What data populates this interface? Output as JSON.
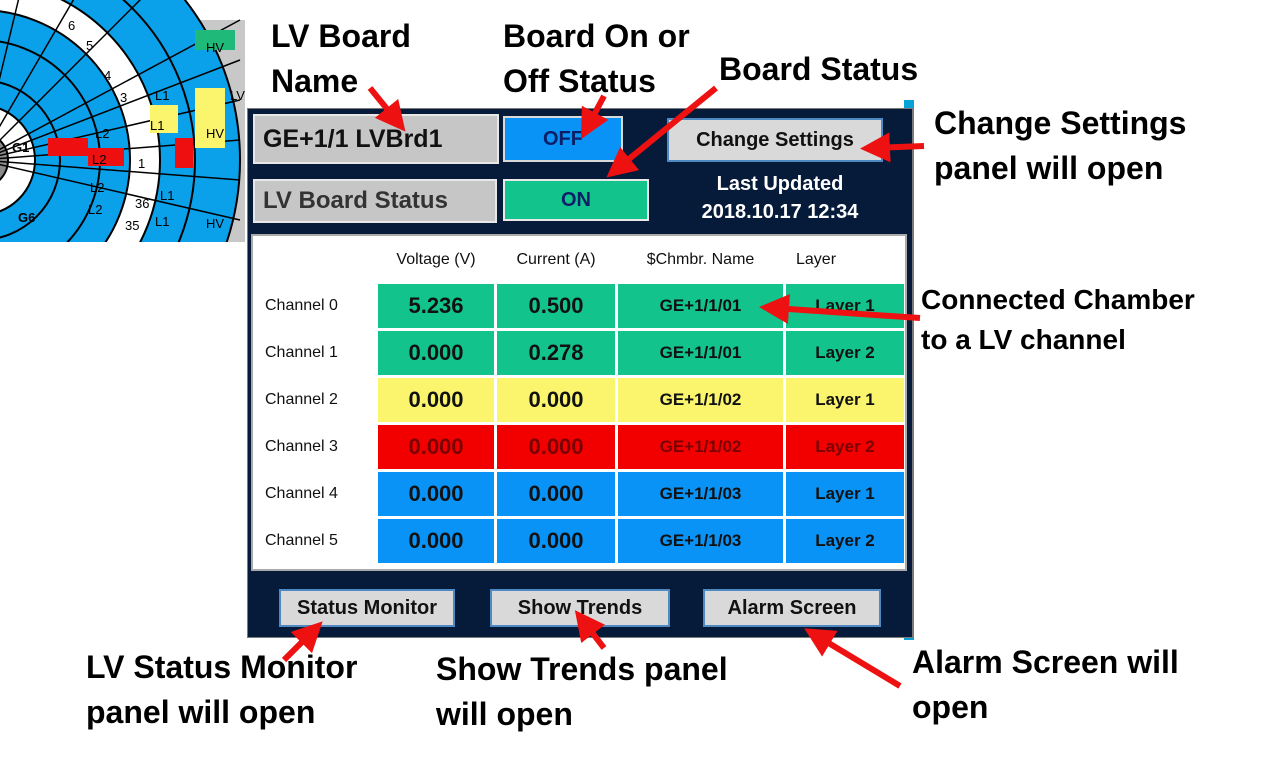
{
  "board": {
    "name": "GE+1/1 LVBrd1",
    "onoff": "OFF",
    "change_settings": "Change Settings",
    "status_label": "LV Board Status",
    "status_value": "ON",
    "last_updated_title": "Last Updated",
    "last_updated_value": "2018.10.17  12:34"
  },
  "table": {
    "headers": [
      "Voltage (V)",
      "Current (A)",
      "$Chmbr. Name",
      "Layer"
    ],
    "rows": [
      {
        "label": "Channel 0",
        "voltage": "5.236",
        "current": "0.500",
        "chamber": "GE+1/1/01",
        "layer": "Layer 1",
        "color": "#12c48c",
        "text": "#111111"
      },
      {
        "label": "Channel 1",
        "voltage": "0.000",
        "current": "0.278",
        "chamber": "GE+1/1/01",
        "layer": "Layer 2",
        "color": "#12c48c",
        "text": "#111111"
      },
      {
        "label": "Channel 2",
        "voltage": "0.000",
        "current": "0.000",
        "chamber": "GE+1/1/02",
        "layer": "Layer 1",
        "color": "#fbf56e",
        "text": "#111111"
      },
      {
        "label": "Channel 3",
        "voltage": "0.000",
        "current": "0.000",
        "chamber": "GE+1/1/02",
        "layer": "Layer 2",
        "color": "#f20000",
        "text": "#7a0000"
      },
      {
        "label": "Channel 4",
        "voltage": "0.000",
        "current": "0.000",
        "chamber": "GE+1/1/03",
        "layer": "Layer 1",
        "color": "#0a93f7",
        "text": "#111111"
      },
      {
        "label": "Channel 5",
        "voltage": "0.000",
        "current": "0.000",
        "chamber": "GE+1/1/03",
        "layer": "Layer 2",
        "color": "#0a93f7",
        "text": "#111111"
      }
    ]
  },
  "buttons": {
    "status_monitor": "Status Monitor",
    "show_trends": "Show Trends",
    "alarm_screen": "Alarm Screen"
  },
  "annotations": {
    "lv_board_name_1": "LV Board",
    "lv_board_name_2": "Name",
    "board_onoff_1": "Board On or",
    "board_onoff_2": "Off Status",
    "board_status": "Board Status",
    "change_settings_1": "Change Settings",
    "change_settings_2": "panel will open",
    "connected_1": "Connected Chamber",
    "connected_2": "to a LV channel",
    "status_monitor_1": "LV Status Monitor",
    "status_monitor_2": "panel will open",
    "show_trends_1": "Show Trends panel",
    "show_trends_2": "will open",
    "alarm_1": "Alarm Screen will",
    "alarm_2": "open"
  },
  "wheel": {
    "labels": [
      "L2",
      "L2",
      "L2",
      "L1",
      "L1",
      "L1",
      "L2",
      "L2",
      "L2",
      "L1",
      "L1",
      "L1",
      "6",
      "5",
      "4",
      "3",
      "2",
      "1",
      "36",
      "35",
      "G1",
      "G6",
      "HV",
      "HV",
      "HV",
      "LV"
    ],
    "colors": {
      "blue": "#0aa1ea",
      "red": "#ee1010",
      "yellow": "#fbf56e",
      "green": "#1fba7a",
      "gray": "#c8c8c8"
    }
  },
  "colors": {
    "arrow": "#ee1111",
    "panel_bg": "#061a3a"
  }
}
